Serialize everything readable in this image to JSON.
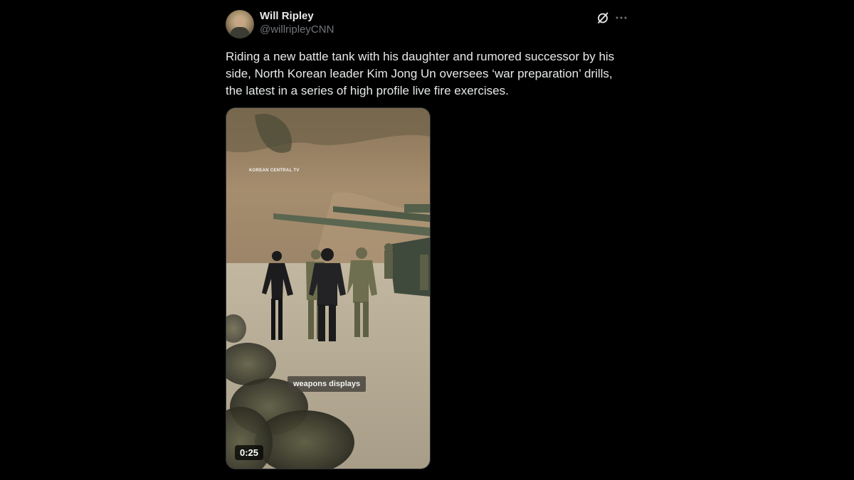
{
  "post": {
    "author": {
      "display_name": "Will Ripley",
      "handle": "@willripleyCNN",
      "avatar_icon": "user-avatar"
    },
    "actions": {
      "grok_icon": "grok-slash-circle-icon",
      "more_icon": "more-horizontal-icon"
    },
    "text": "Riding a new battle tank with his daughter and rumored successor by his side, North Korean leader Kim Jong Un oversees ‘war preparation’ drills, the latest in a series of high profile live fire exercises.",
    "media": {
      "type": "video",
      "watermark": "KOREAN CENTRAL TV",
      "caption": "weapons displays",
      "duration": "0:25"
    }
  },
  "colors": {
    "background": "#000000",
    "primary_text": "#e7e9ea",
    "secondary_text": "#71767b",
    "border": "#2f3336"
  }
}
